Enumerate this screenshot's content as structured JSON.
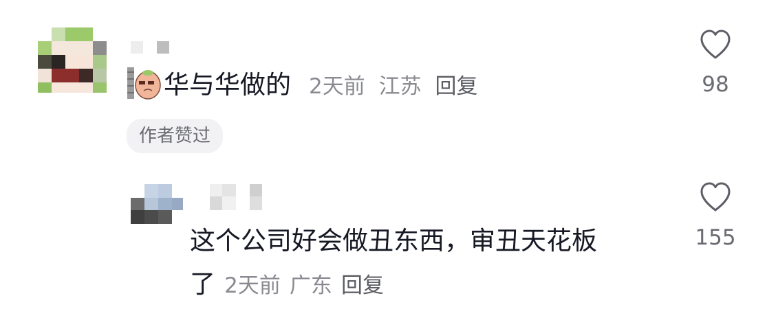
{
  "comments": [
    {
      "text": "华与华做的",
      "time": "2天前",
      "location": "江苏",
      "reply_label": "回复",
      "like_count": "98",
      "badge": "作者赞过"
    },
    {
      "text_line1": "这个公司好会做丑东西，审丑天花板",
      "text_line2": "了",
      "time": "2天前",
      "location": "广东",
      "reply_label": "回复",
      "like_count": "155"
    }
  ],
  "icons": {
    "like": "heart-outline-icon",
    "sticker": "potato-face-sticker-icon"
  },
  "colors": {
    "text": "#161823",
    "meta": "#8a8b91",
    "badge_bg": "#f2f2f4"
  }
}
